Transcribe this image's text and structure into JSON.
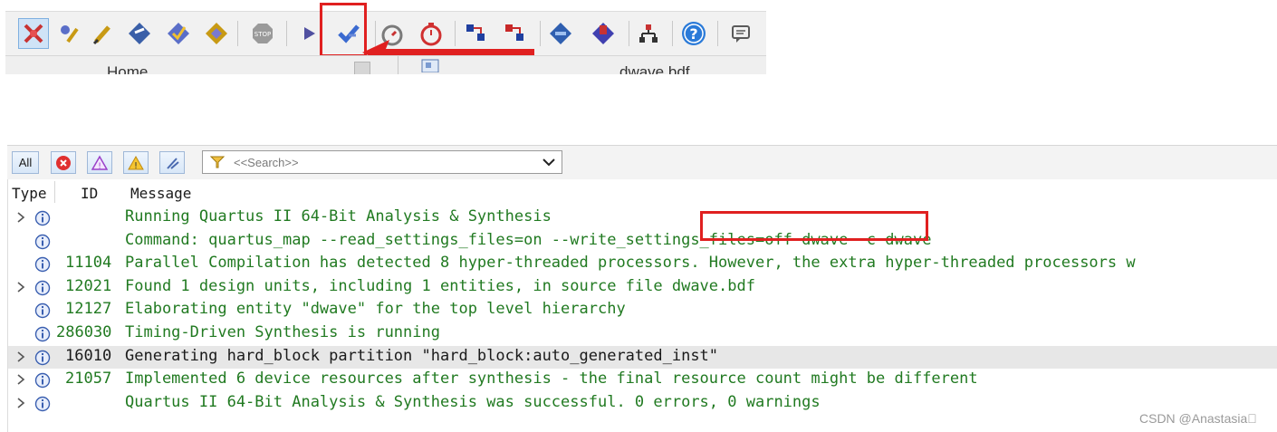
{
  "toolbar": {
    "buttons": [
      {
        "name": "netlist-viewer-button",
        "icon": "cross-star-icon",
        "color": "#c83232"
      },
      {
        "name": "assignment-editor-button",
        "icon": "pin-pen-icon",
        "color": "#c89a14"
      },
      {
        "name": "pin-planner-button",
        "icon": "pencil-icon",
        "color": "#c89a14"
      },
      {
        "name": "compile-design-button",
        "icon": "chip-arrow-icon",
        "color": "#3a5fa8"
      },
      {
        "name": "analysis-elaboration-button",
        "icon": "chip-check-icon",
        "color": "#5a6ec8"
      },
      {
        "name": "fitter-button",
        "icon": "chip-diamond-icon",
        "color": "#c89a14"
      },
      {
        "name": "stop-button",
        "icon": "stop-icon",
        "label": "STOP"
      },
      {
        "name": "start-compilation-button",
        "icon": "play-icon",
        "color": "#5050a0"
      },
      {
        "name": "start-analysis-synthesis-button",
        "icon": "check-arrow-icon",
        "color": "#3a6ad0"
      },
      {
        "name": "timing-analyzer-button",
        "icon": "stopwatch-gear-icon",
        "color": "#7a7a7a"
      },
      {
        "name": "timequest-button",
        "icon": "stopwatch-icon",
        "color": "#d03030"
      },
      {
        "name": "rtl-viewer-button",
        "icon": "flow-blue-icon",
        "color": "#2040a0"
      },
      {
        "name": "technology-map-viewer-button",
        "icon": "flow-red-icon",
        "color": "#c82828"
      },
      {
        "name": "chip-planner-button",
        "icon": "diamond-chip-icon",
        "color": "#2f5fb0"
      },
      {
        "name": "programmer-button",
        "icon": "diamond-hand-icon",
        "color": "#4040b0"
      },
      {
        "name": "design-partition-button",
        "icon": "hierarchy-icon",
        "color": "#c83232"
      },
      {
        "name": "help-button",
        "icon": "question-circle-icon",
        "color": "#2a7ad8"
      },
      {
        "name": "messages-button",
        "icon": "speech-bubble-icon",
        "color": "#5a5a5a"
      }
    ],
    "tabs": {
      "home": "Home",
      "file": "dwave.bdf"
    }
  },
  "messages": {
    "filters": {
      "all": "All",
      "search_placeholder": "<<Search>>"
    },
    "columns": {
      "type": "Type",
      "id": "ID",
      "message": "Message"
    },
    "rows": [
      {
        "expand": true,
        "id": "",
        "text": "Running Quartus II 64-Bit Analysis & Synthesis"
      },
      {
        "expand": false,
        "id": "",
        "text": "Command: quartus_map --read_settings_files=on --write_settings_files=off dwave -c dwave"
      },
      {
        "expand": false,
        "id": "11104",
        "text": "Parallel Compilation has detected 8 hyper-threaded processors. However, the extra hyper-threaded processors w"
      },
      {
        "expand": true,
        "id": "12021",
        "text": "Found 1 design units, including 1 entities, in source file dwave.bdf"
      },
      {
        "expand": false,
        "id": "12127",
        "text": "Elaborating entity \"dwave\" for the top level hierarchy"
      },
      {
        "expand": false,
        "id": "286030",
        "text": "Timing-Driven Synthesis is running"
      },
      {
        "expand": true,
        "id": "16010",
        "text": "Generating hard_block partition \"hard_block:auto_generated_inst\"",
        "selected": true
      },
      {
        "expand": true,
        "id": "21057",
        "text": "Implemented 6 device resources after synthesis - the final resource count might be different"
      },
      {
        "expand": true,
        "id": "",
        "text": "Quartus II 64-Bit Analysis & Synthesis was successful. 0 errors, 0 warnings"
      }
    ]
  },
  "colors": {
    "message_green": "#217a21",
    "annotation_red": "#e02020",
    "selected_row": "#e7e7e7"
  },
  "watermark": "CSDN @Anastasia\u0000"
}
